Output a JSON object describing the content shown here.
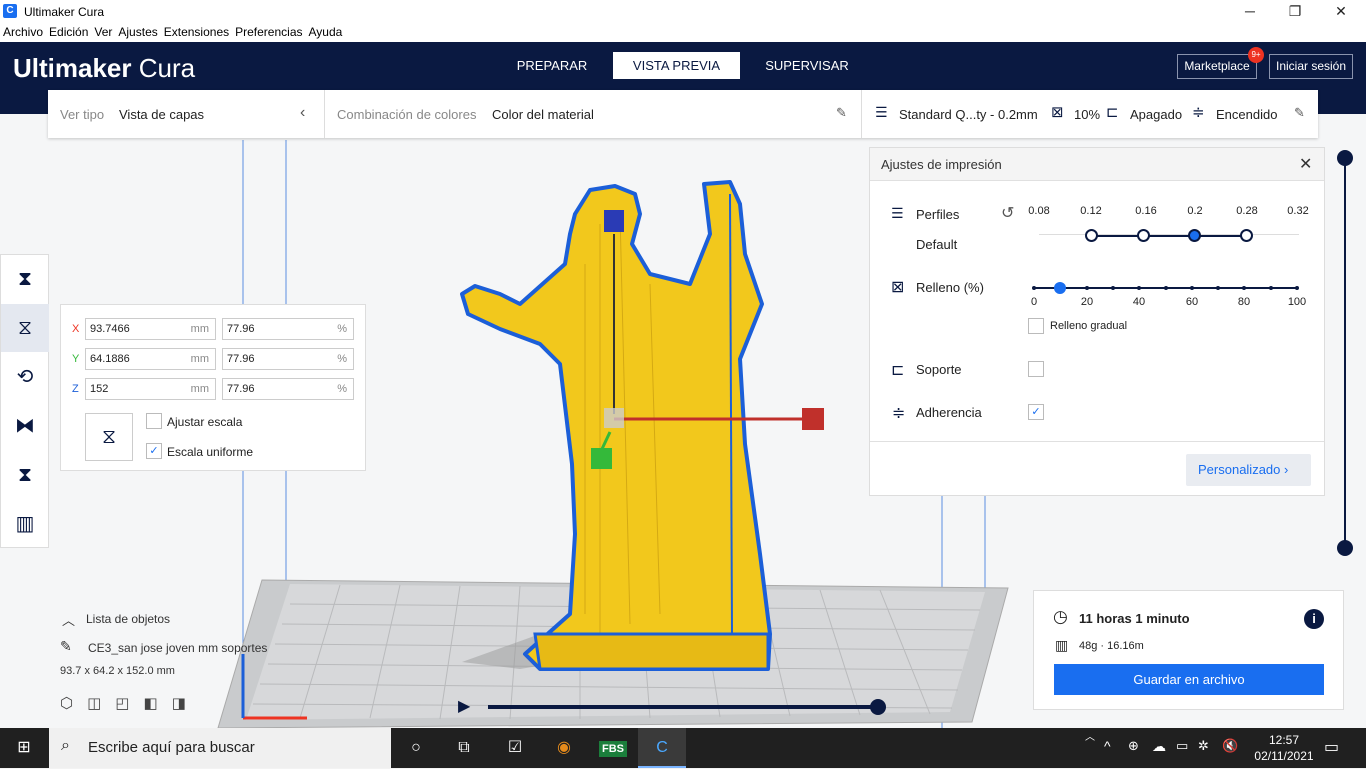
{
  "window": {
    "title": "Ultimaker Cura",
    "minimize": "─",
    "maximize": "❐",
    "close": "✕",
    "logo": "C"
  },
  "menu": [
    "Archivo",
    "Edición",
    "Ver",
    "Ajustes",
    "Extensiones",
    "Preferencias",
    "Ayuda"
  ],
  "header": {
    "brand_bold": "Ultimaker",
    "brand_light": " Cura",
    "tabs": [
      "PREPARAR",
      "VISTA PREVIA",
      "SUPERVISAR"
    ],
    "active_tab": "VISTA PREVIA",
    "marketplace": "Marketplace",
    "marketplace_badge": "9+",
    "login": "Iniciar sesión"
  },
  "view_bar": {
    "view_type_label": "Ver tipo",
    "view_type_value": "Vista de capas",
    "color_scheme_label": "Combinación de colores",
    "color_scheme_value": "Color del material",
    "profile": "Standard Q...ty - 0.2mm",
    "infill": "10%",
    "support": "Apagado",
    "adhesion": "Encendido"
  },
  "scale": {
    "x_label": "X",
    "x_mm": "93.7466",
    "x_pct": "77.96",
    "y_label": "Y",
    "y_mm": "64.1886",
    "y_pct": "77.96",
    "z_label": "Z",
    "z_mm": "152",
    "z_pct": "77.96",
    "unit_mm": "mm",
    "unit_pct": "%",
    "snap_label": "Ajustar escala",
    "snap_checked": false,
    "uniform_label": "Escala uniforme",
    "uniform_checked": true
  },
  "print_settings": {
    "title": "Ajustes de impresión",
    "profiles_label": "Perfiles",
    "profiles_sub": "Default",
    "layer_heights": [
      "0.08",
      "0.12",
      "0.16",
      "0.2",
      "0.28",
      "0.32"
    ],
    "selected_layer_height": "0.2",
    "infill_label": "Relleno (%)",
    "infill_ticks": [
      "0",
      "20",
      "40",
      "60",
      "80",
      "100"
    ],
    "infill_value": 10,
    "gradual_label": "Relleno gradual",
    "support_label": "Soporte",
    "support_checked": false,
    "adhesion_label": "Adherencia",
    "adhesion_checked": true,
    "custom_button": "Personalizado"
  },
  "objects": {
    "list_label": "Lista de objetos",
    "object_name": "CE3_san jose joven mm soportes",
    "dimensions": "93.7 x 64.2 x 152.0 mm"
  },
  "estimate": {
    "time": "11 horas 1 minuto",
    "material": "48g · 16.16m",
    "save_button": "Guardar en archivo"
  },
  "layer_slider": {
    "top_fraction": 1.0,
    "bottom_fraction": 0.0
  },
  "playback": {
    "progress": 1.0
  },
  "taskbar": {
    "search_placeholder": "Escribe aquí para buscar",
    "fbs_label": "FBS",
    "time": "12:57",
    "date": "02/11/2021"
  },
  "colors": {
    "header": "#0a1941",
    "accent": "#196ef0",
    "model": "#f2c81c",
    "outline": "#1c5fd8"
  }
}
